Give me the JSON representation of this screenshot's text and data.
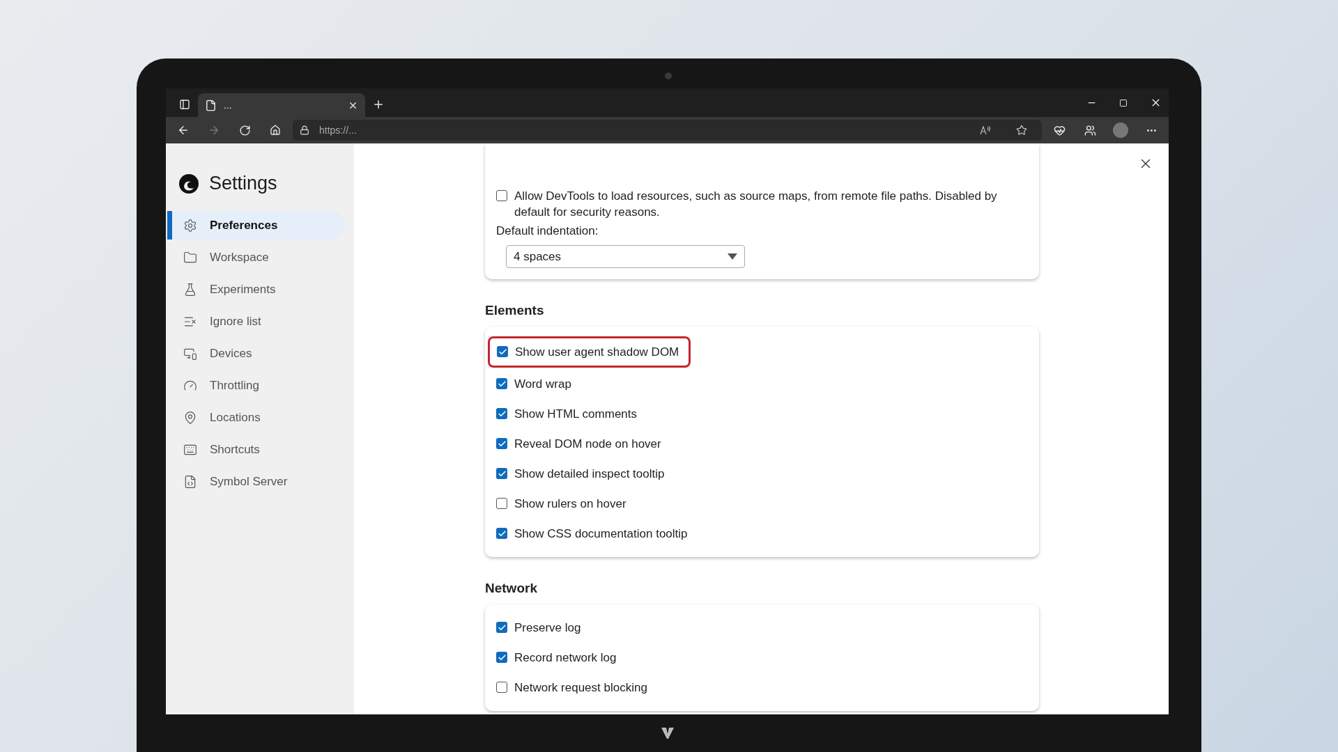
{
  "browser": {
    "tab": {
      "title": "..."
    },
    "address": "https://..."
  },
  "sidebar": {
    "title": "Settings",
    "items": [
      {
        "label": "Preferences",
        "selected": true
      },
      {
        "label": "Workspace",
        "selected": false
      },
      {
        "label": "Experiments",
        "selected": false
      },
      {
        "label": "Ignore list",
        "selected": false
      },
      {
        "label": "Devices",
        "selected": false
      },
      {
        "label": "Throttling",
        "selected": false
      },
      {
        "label": "Locations",
        "selected": false
      },
      {
        "label": "Shortcuts",
        "selected": false
      },
      {
        "label": "Symbol Server",
        "selected": false
      }
    ]
  },
  "sections": [
    {
      "items": [
        {
          "kind": "checkbox",
          "label": "Allow DevTools to load resources, such as source maps, from remote file paths. Disabled by default for security reasons.",
          "checked": false,
          "highlighted": false
        },
        {
          "kind": "select",
          "label": "Default indentation:",
          "value": "4 spaces"
        }
      ]
    },
    {
      "heading": "Elements",
      "items": [
        {
          "kind": "checkbox",
          "label": "Show user agent shadow DOM",
          "checked": true,
          "highlighted": true
        },
        {
          "kind": "checkbox",
          "label": "Word wrap",
          "checked": true,
          "highlighted": false
        },
        {
          "kind": "checkbox",
          "label": "Show HTML comments",
          "checked": true,
          "highlighted": false
        },
        {
          "kind": "checkbox",
          "label": "Reveal DOM node on hover",
          "checked": true,
          "highlighted": false
        },
        {
          "kind": "checkbox",
          "label": "Show detailed inspect tooltip",
          "checked": true,
          "highlighted": false
        },
        {
          "kind": "checkbox",
          "label": "Show rulers on hover",
          "checked": false,
          "highlighted": false
        },
        {
          "kind": "checkbox",
          "label": "Show CSS documentation tooltip",
          "checked": true,
          "highlighted": false
        }
      ]
    },
    {
      "heading": "Network",
      "items": [
        {
          "kind": "checkbox",
          "label": "Preserve log",
          "checked": true,
          "highlighted": false
        },
        {
          "kind": "checkbox",
          "label": "Record network log",
          "checked": true,
          "highlighted": false
        },
        {
          "kind": "checkbox",
          "label": "Network request blocking",
          "checked": false,
          "highlighted": false
        }
      ]
    }
  ]
}
